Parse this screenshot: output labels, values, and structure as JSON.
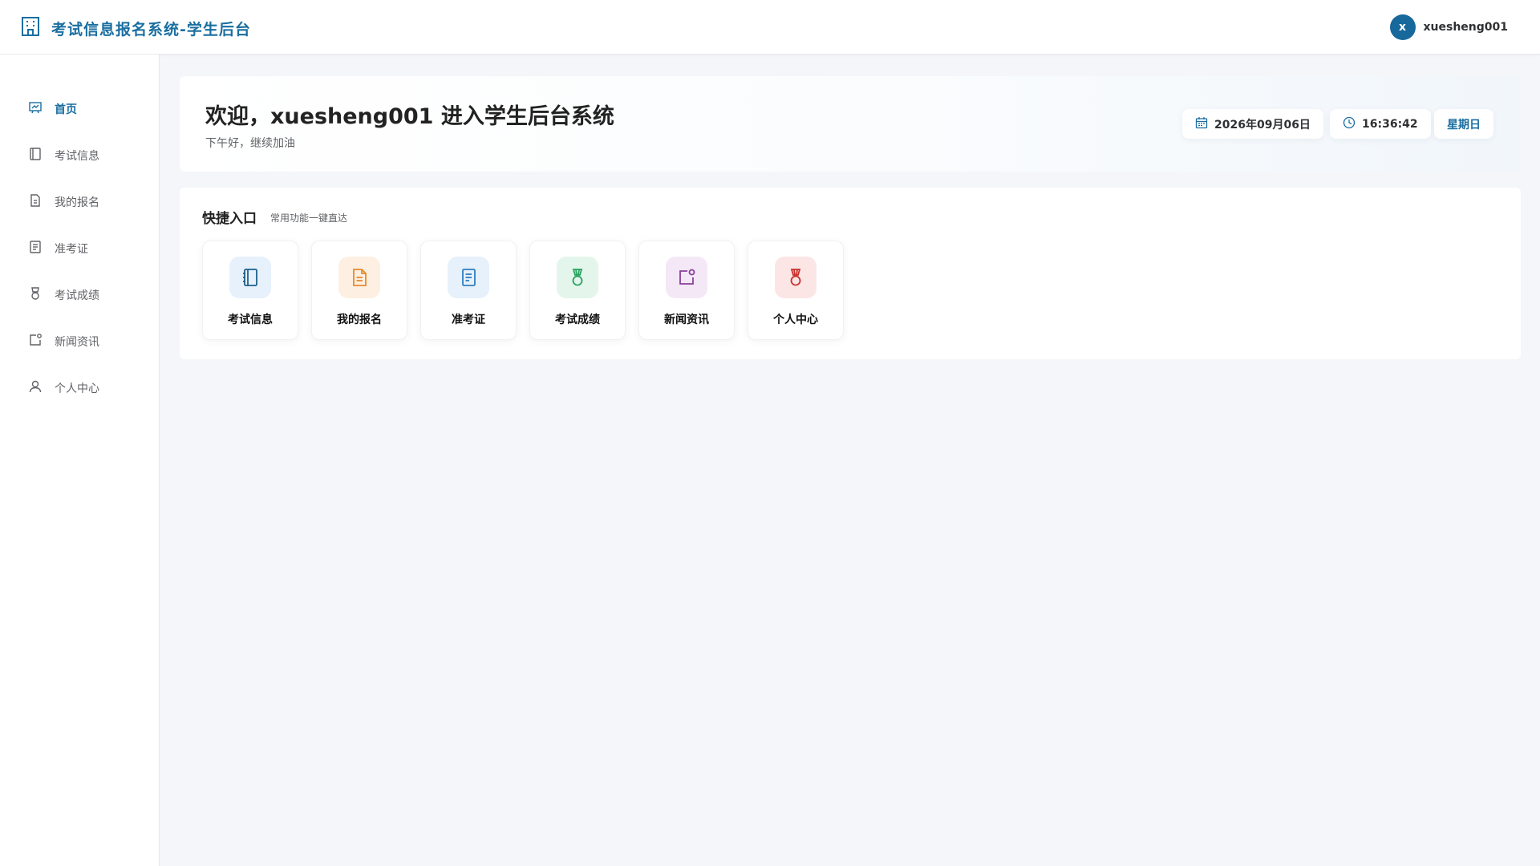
{
  "header": {
    "title": "考试信息报名系统-学生后台",
    "avatar_letter": "x",
    "username": "xuesheng001"
  },
  "sidebar": {
    "items": [
      {
        "label": "首页",
        "icon": "presentation-chart-icon",
        "active": true
      },
      {
        "label": "考试信息",
        "icon": "notebook-icon",
        "active": false
      },
      {
        "label": "我的报名",
        "icon": "document-icon",
        "active": false
      },
      {
        "label": "准考证",
        "icon": "ticket-document-icon",
        "active": false
      },
      {
        "label": "考试成绩",
        "icon": "medal-icon",
        "active": false
      },
      {
        "label": "新闻资讯",
        "icon": "news-icon",
        "active": false
      },
      {
        "label": "个人中心",
        "icon": "user-icon",
        "active": false
      }
    ]
  },
  "welcome": {
    "title": "欢迎，xuesheng001 进入学生后台系统",
    "subtitle": "下午好，继续加油",
    "date": "2026年09月06日",
    "time": "16:36:42",
    "weekday": "星期日"
  },
  "quick": {
    "title": "快捷入口",
    "subtitle": "常用功能一键直达",
    "cards": [
      {
        "label": "考试信息",
        "icon": "notebook-icon",
        "color": "#1e5f8c",
        "bg": "#e7f1fb"
      },
      {
        "label": "我的报名",
        "icon": "document-icon",
        "color": "#e68a2e",
        "bg": "#fdf0e2"
      },
      {
        "label": "准考证",
        "icon": "ticket-document-icon",
        "color": "#2f7fc0",
        "bg": "#e6f1fb"
      },
      {
        "label": "考试成绩",
        "icon": "medal-icon",
        "color": "#27a35f",
        "bg": "#e4f6ec"
      },
      {
        "label": "新闻资讯",
        "icon": "news-icon",
        "color": "#8a3f9b",
        "bg": "#f4e8f7"
      },
      {
        "label": "个人中心",
        "icon": "medal-icon",
        "color": "#c9302c",
        "bg": "#fbe6e5"
      }
    ]
  },
  "colors": {
    "brand": "#1a6ea0",
    "avatar": "#17689b",
    "background": "#f4f6f9"
  }
}
